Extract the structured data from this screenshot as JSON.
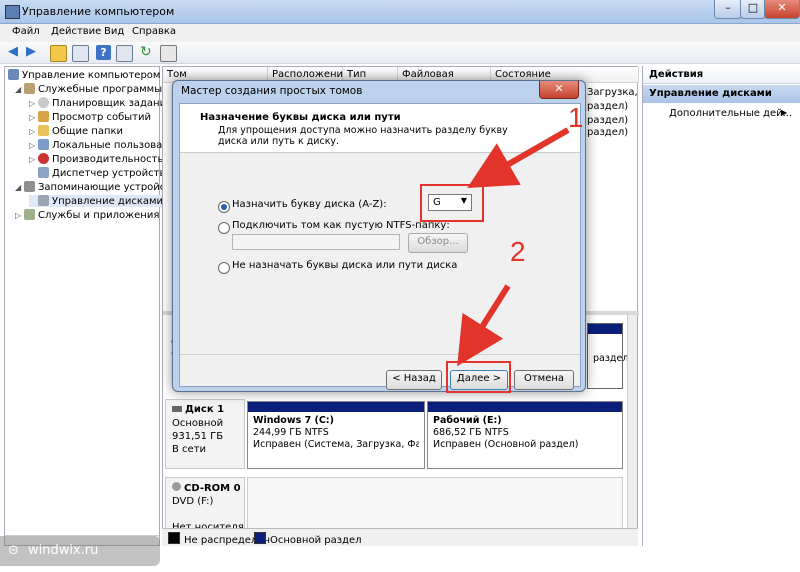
{
  "window": {
    "title": "Управление компьютером",
    "minimize": "–",
    "maximize": "□",
    "close": "✕"
  },
  "menu": [
    "Файл",
    "Действие",
    "Вид",
    "Справка"
  ],
  "tree": {
    "root": "Управление компьютером (л",
    "items": [
      {
        "label": "Служебные программы"
      },
      {
        "label": "Планировщик заданий"
      },
      {
        "label": "Просмотр событий"
      },
      {
        "label": "Общие папки"
      },
      {
        "label": "Локальные пользовате"
      },
      {
        "label": "Производительность"
      },
      {
        "label": "Диспетчер устройств"
      },
      {
        "label": "Запоминающие устройст"
      },
      {
        "label": "Управление дисками"
      },
      {
        "label": "Службы и приложения"
      }
    ]
  },
  "columns": [
    "Том",
    "Расположение",
    "Тип",
    "Файловая система",
    "Состояние"
  ],
  "bg_status": [
    "Загрузка, ",
    "раздел)",
    "раздел)",
    "раздел)"
  ],
  "disks": [
    {
      "name": "Диск 1",
      "type": "Основной",
      "size": "931,51 ГБ",
      "status": "В сети",
      "partitions": [
        {
          "name": "Windows 7  (C:)",
          "size": "244,99 ГБ NTFS",
          "status": "Исправен (Система, Загрузка, Файл п"
        },
        {
          "name": "Рабочий  (E:)",
          "size": "686,52 ГБ NTFS",
          "status": "Исправен (Основной раздел)"
        }
      ]
    },
    {
      "name": "CD-ROM 0",
      "type": "DVD (F:)",
      "size": "",
      "status": "Нет носителя"
    }
  ],
  "disk0_partial": [
    "О",
    "9",
    "В"
  ],
  "disk0_right": [
    "раздел)"
  ],
  "legend": [
    {
      "label": "Не распределен",
      "color": "#000000"
    },
    {
      "label": "Основной раздел",
      "color": "#0a1f7a"
    }
  ],
  "actions": {
    "header": "Действия",
    "section": "Управление дисками",
    "item": "Дополнительные дей...",
    "item_arrow": "▶"
  },
  "dialog": {
    "title": "Мастер создания простых томов",
    "close": "✕",
    "heading": "Назначение буквы диска или пути",
    "description": "Для упрощения доступа можно назначить разделу букву диска или путь к диску.",
    "option1": "Назначить букву диска (A-Z):",
    "drive_letter": "G",
    "option2": "Подключить том как пустую NTFS-папку:",
    "browse": "Обзор...",
    "option3": "Не назначать буквы диска или пути диска",
    "back": "< Назад",
    "next": "Далее >",
    "cancel": "Отмена"
  },
  "annotations": {
    "one": "1",
    "two": "2",
    "color": "#e2342a"
  },
  "watermark": "windwix.ru"
}
